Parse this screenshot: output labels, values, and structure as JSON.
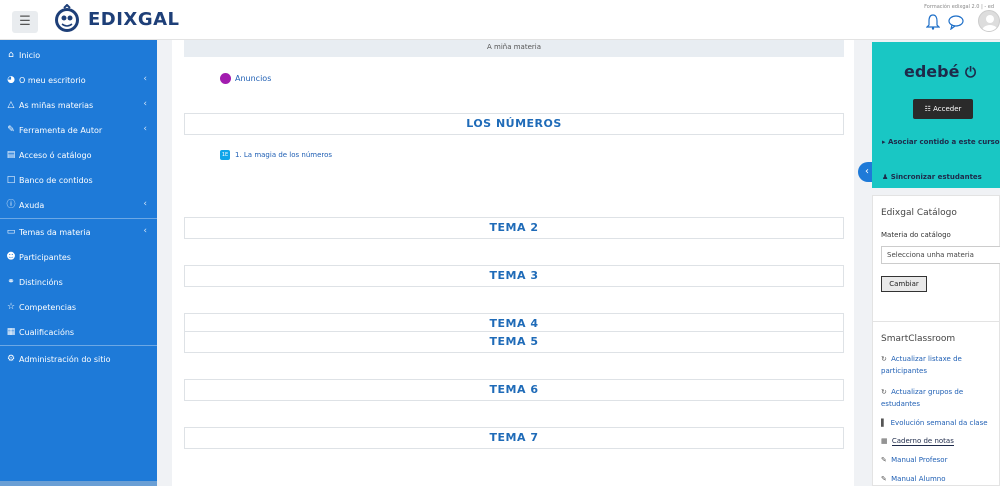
{
  "header": {
    "menu_icon": "hamburger-icon",
    "brand": "EDIXGAL",
    "right_text": "Formación edixgal 2.0 | - ed"
  },
  "sidebar": {
    "items": [
      {
        "label": "Inicio",
        "icon": "home-icon"
      },
      {
        "label": "O meu escritorio",
        "icon": "dashboard-icon"
      },
      {
        "label": "As miñas materias",
        "icon": "graduation-icon"
      },
      {
        "label": "Ferramenta de Autor",
        "icon": "pencil-icon"
      },
      {
        "label": "Acceso ó catálogo",
        "icon": "sitemap-icon"
      },
      {
        "label": "Banco de contidos",
        "icon": "clipboard-icon"
      },
      {
        "label": "Axuda",
        "icon": "help-icon"
      },
      {
        "label": "Temas da materia",
        "icon": "folder-icon"
      },
      {
        "label": "Participantes",
        "icon": "users-icon"
      },
      {
        "label": "Distincións",
        "icon": "badge-icon"
      },
      {
        "label": "Competencias",
        "icon": "star-icon"
      },
      {
        "label": "Cualificacións",
        "icon": "table-icon"
      },
      {
        "label": "Administración do sitio",
        "icon": "cog-icon"
      }
    ]
  },
  "main": {
    "section_header": "A miña materia",
    "anuncios": "Anuncios",
    "sections": [
      "LOS NÚMEROS",
      "TEMA 2",
      "TEMA 3",
      "TEMA 4",
      "TEMA 5",
      "TEMA 6",
      "TEMA 7"
    ],
    "activity": "1. La magia de los números",
    "activity_icon_text": "1E"
  },
  "right": {
    "edebe": {
      "logo": "edebé",
      "acceder": "Acceder",
      "asociar": "Asociar contido a este curso",
      "sincronizar": "Sincronizar estudantes"
    },
    "catalog": {
      "title": "Edixgal Catálogo",
      "label": "Materia do catálogo",
      "select_value": "Selecciona unha materia",
      "button": "Cambiar"
    },
    "smart": {
      "title": "SmartClassroom",
      "links": [
        "Actualizar listaxe de participantes",
        "Actualizar grupos de estudantes",
        "Evolución semanal da clase",
        "Caderno de notas",
        "Manual Profesor",
        "Manual Alumno"
      ]
    }
  }
}
